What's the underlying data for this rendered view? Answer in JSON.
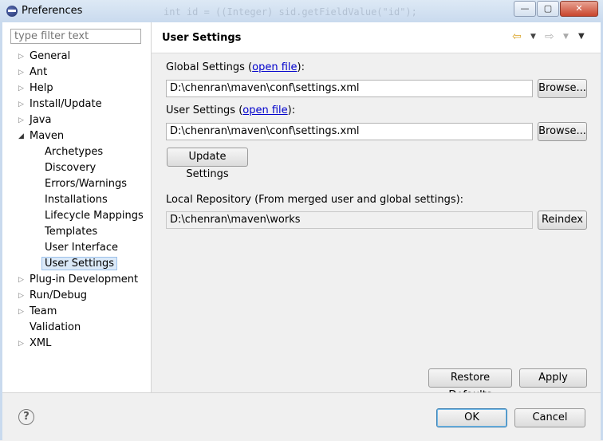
{
  "window": {
    "title": "Preferences",
    "ghost_code": "int id = ((Integer) sid.getFieldValue(\"id\");",
    "min": "—",
    "max": "▢",
    "close": "✕"
  },
  "filter": {
    "placeholder": "type filter text"
  },
  "tree": {
    "general": "General",
    "ant": "Ant",
    "help": "Help",
    "install_update": "Install/Update",
    "java": "Java",
    "maven": "Maven",
    "archetypes": "Archetypes",
    "discovery": "Discovery",
    "errors_warnings": "Errors/Warnings",
    "installations": "Installations",
    "lifecycle_mappings": "Lifecycle Mappings",
    "templates": "Templates",
    "user_interface": "User Interface",
    "user_settings": "User Settings",
    "plugin_development": "Plug-in Development",
    "run_debug": "Run/Debug",
    "team": "Team",
    "validation": "Validation",
    "xml": "XML"
  },
  "page": {
    "title": "User Settings",
    "global_label_pre": "Global Settings (",
    "open_file": "open file",
    "label_post": "):",
    "global_value": "D:\\chenran\\maven\\conf\\settings.xml",
    "user_label_pre": "User Settings (",
    "user_value": "D:\\chenran\\maven\\conf\\settings.xml",
    "browse": "Browse...",
    "update_settings": "Update Settings",
    "local_repo_label": "Local Repository (From merged user and global settings):",
    "local_repo_value": "D:\\chenran\\maven\\works",
    "reindex": "Reindex",
    "restore_defaults": "Restore Defaults",
    "apply": "Apply"
  },
  "footer": {
    "ok": "OK",
    "cancel": "Cancel"
  },
  "icons": {
    "back": "back-arrow-icon",
    "forward": "forward-arrow-icon",
    "menu": "view-menu-icon",
    "help": "help-icon"
  }
}
